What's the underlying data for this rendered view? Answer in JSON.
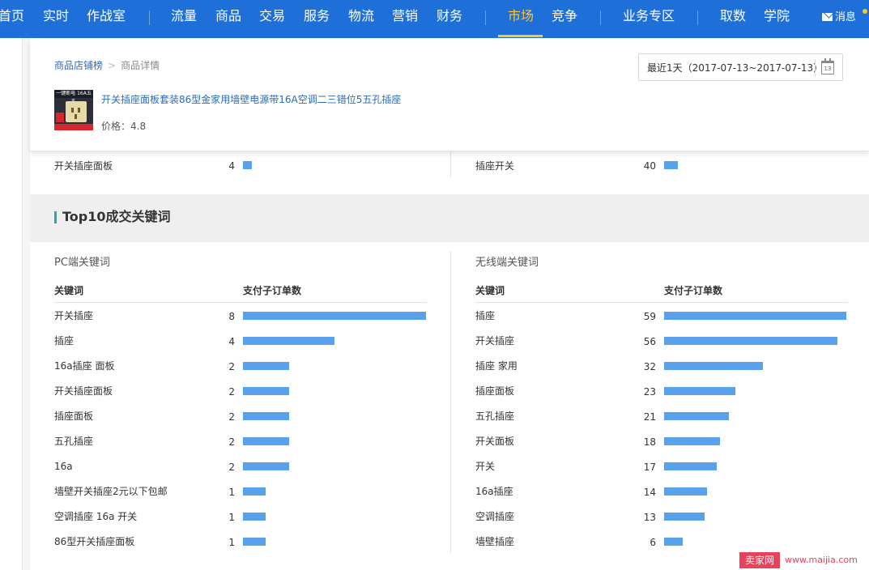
{
  "nav": {
    "items": [
      {
        "label": "首页"
      },
      {
        "label": "实时"
      },
      {
        "label": "作战室"
      },
      {
        "label": "流量"
      },
      {
        "label": "商品"
      },
      {
        "label": "交易"
      },
      {
        "label": "服务"
      },
      {
        "label": "物流"
      },
      {
        "label": "营销"
      },
      {
        "label": "财务"
      },
      {
        "label": "市场"
      },
      {
        "label": "竞争"
      },
      {
        "label": "业务专区"
      },
      {
        "label": "取数"
      },
      {
        "label": "学院"
      }
    ],
    "active": "市场",
    "message_label": "消息",
    "colors": {
      "bar": "#1f6fd8",
      "active": "#ffc627"
    }
  },
  "breadcrumb": {
    "parent": "商品店铺榜",
    "separator": ">",
    "current": "商品详情"
  },
  "date_range": {
    "label": "最近1天（2017-07-13~2017-07-13）",
    "calendar_day": "13"
  },
  "product": {
    "title": "开关插座面板套装86型金家用墙壁电源带16A空调二三错位5五孔插座",
    "price": "价格：4.8",
    "thumb_text": "一键断电 16A五孔"
  },
  "partial_rows": {
    "left": {
      "label": "开关插座面板",
      "value": "4"
    },
    "right": {
      "label": "插座开关",
      "value": "40"
    }
  },
  "section": {
    "title": "Top10成交关键词"
  },
  "pc_keywords": {
    "subtitle": "PC端关键词",
    "col_keyword": "关键词",
    "col_orders": "支付子订单数",
    "rows": [
      {
        "label": "开关插座",
        "value": "8"
      },
      {
        "label": "插座",
        "value": "4"
      },
      {
        "label": "16a插座 面板",
        "value": "2"
      },
      {
        "label": "开关插座面板",
        "value": "2"
      },
      {
        "label": "插座面板",
        "value": "2"
      },
      {
        "label": "五孔插座",
        "value": "2"
      },
      {
        "label": "16a",
        "value": "2"
      },
      {
        "label": "墙壁开关插座2元以下包邮",
        "value": "1"
      },
      {
        "label": "空调插座 16a 开关",
        "value": "1"
      },
      {
        "label": "86型开关插座面板",
        "value": "1"
      }
    ]
  },
  "mobile_keywords": {
    "subtitle": "无线端关键词",
    "col_keyword": "关键词",
    "col_orders": "支付子订单数",
    "rows": [
      {
        "label": "插座",
        "value": "59"
      },
      {
        "label": "开关插座",
        "value": "56"
      },
      {
        "label": "插座 家用",
        "value": "32"
      },
      {
        "label": "插座面板",
        "value": "23"
      },
      {
        "label": "五孔插座",
        "value": "21"
      },
      {
        "label": "开关面板",
        "value": "18"
      },
      {
        "label": "开关",
        "value": "17"
      },
      {
        "label": "16a插座",
        "value": "14"
      },
      {
        "label": "空调插座",
        "value": "13"
      },
      {
        "label": "墙壁插座",
        "value": "6"
      }
    ]
  },
  "watermark": {
    "badge": "卖家网",
    "url": "www.maijia.com"
  },
  "bar_color": "#5aa1ec"
}
